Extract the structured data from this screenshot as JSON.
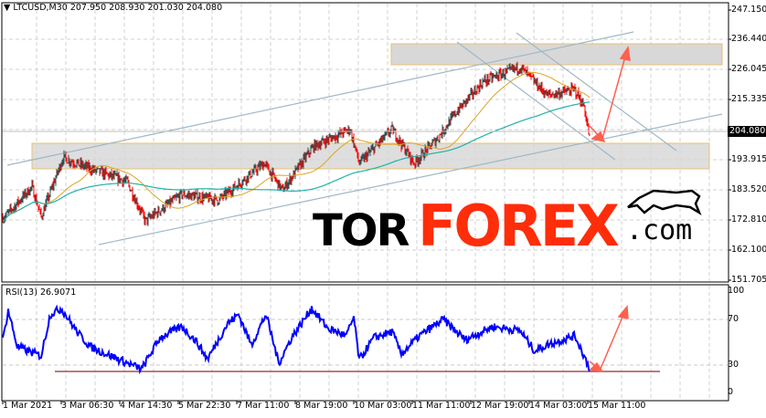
{
  "header": {
    "symbol": "LTCUSD,M30",
    "open": "207.950",
    "high": "208.930",
    "low": "201.030",
    "close": "204.080"
  },
  "price_axis": [
    "247.150",
    "236.440",
    "226.045",
    "215.335",
    "204.080",
    "193.915",
    "183.520",
    "172.810",
    "162.100",
    "151.705"
  ],
  "current_price": "204.080",
  "rsi": {
    "label": "RSI(13) 26.9071",
    "axis": [
      "100",
      "70",
      "30",
      "0"
    ]
  },
  "time_axis": [
    "1 Mar 2021",
    "3 Mar 06:30",
    "4 Mar 14:30",
    "5 Mar 22:30",
    "7 Mar 11:00",
    "8 Mar 19:00",
    "10 Mar 03:00",
    "11 Mar 11:00",
    "12 Mar 19:00",
    "14 Mar 03:00",
    "15 Mar 11:00"
  ],
  "logo": {
    "part1": "TOR",
    "part2": "FOREX",
    "part3": ".com"
  },
  "colors": {
    "bull": "#2f4f4f",
    "bear": "#ff0000",
    "ma_fast": "#daa520",
    "ma_slow": "#20b2aa",
    "rsi": "#0000ff",
    "arrow": "#ff6050",
    "zone": "#d8d8d8"
  },
  "chart_data": {
    "type": "candlestick",
    "title": "LTCUSD,M30",
    "x_unit": "hours since 1 Mar 2021",
    "ylim": [
      151.705,
      247.15
    ],
    "price_keypoints": [
      [
        1,
        174
      ],
      [
        16,
        184.7
      ],
      [
        21,
        174
      ],
      [
        33,
        195
      ],
      [
        48,
        191
      ],
      [
        68,
        186.5
      ],
      [
        78,
        172.6
      ],
      [
        98,
        182
      ],
      [
        118,
        180
      ],
      [
        143,
        193
      ],
      [
        153,
        183.5
      ],
      [
        170,
        199
      ],
      [
        190,
        205
      ],
      [
        195,
        193
      ],
      [
        213,
        205
      ],
      [
        225,
        193
      ],
      [
        238,
        202
      ],
      [
        248,
        211
      ],
      [
        263,
        222
      ],
      [
        283,
        227
      ],
      [
        298,
        217
      ],
      [
        313,
        219
      ],
      [
        318,
        213
      ],
      [
        321,
        202
      ]
    ],
    "rsi_keypoints": [
      [
        0,
        51
      ],
      [
        3,
        81
      ],
      [
        8,
        45
      ],
      [
        21,
        36
      ],
      [
        26,
        77
      ],
      [
        32,
        83
      ],
      [
        41,
        59
      ],
      [
        48,
        45
      ],
      [
        68,
        29
      ],
      [
        76,
        23
      ],
      [
        86,
        54
      ],
      [
        98,
        65
      ],
      [
        106,
        50
      ],
      [
        112,
        33
      ],
      [
        123,
        68
      ],
      [
        129,
        77
      ],
      [
        136,
        47
      ],
      [
        144,
        77
      ],
      [
        151,
        29
      ],
      [
        158,
        54
      ],
      [
        169,
        83
      ],
      [
        178,
        63
      ],
      [
        188,
        56
      ],
      [
        192,
        74
      ],
      [
        195,
        32
      ],
      [
        203,
        54
      ],
      [
        213,
        60
      ],
      [
        218,
        38
      ],
      [
        228,
        56
      ],
      [
        241,
        72
      ],
      [
        253,
        52
      ],
      [
        268,
        65
      ],
      [
        283,
        61
      ],
      [
        291,
        41
      ],
      [
        298,
        47
      ],
      [
        313,
        56
      ],
      [
        321,
        24
      ]
    ],
    "rsi_levels": [
      70,
      30
    ]
  }
}
